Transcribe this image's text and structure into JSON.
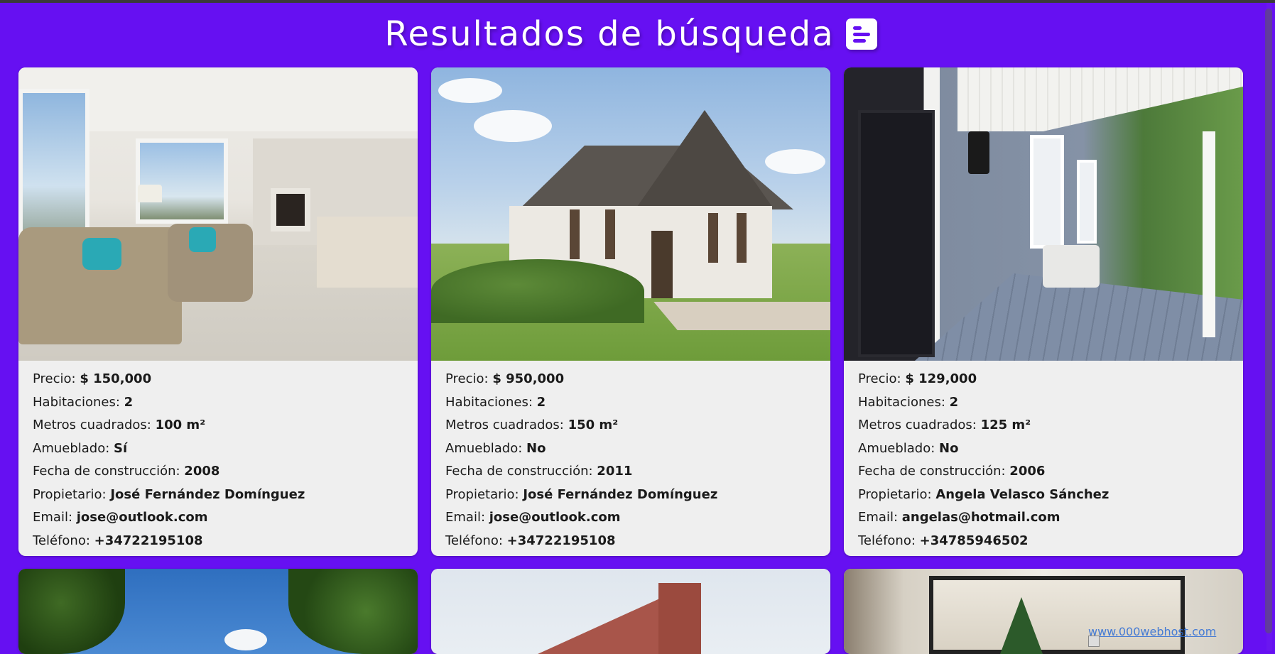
{
  "page": {
    "title": "Resultados de búsqueda",
    "title_icon": "list-icon"
  },
  "labels": {
    "price": "Precio:",
    "rooms": "Habitaciones:",
    "area": "Metros cuadrados:",
    "furnished": "Amueblado:",
    "built": "Fecha de construcción:",
    "owner": "Propietario:",
    "email": "Email:",
    "phone": "Teléfono:"
  },
  "listings": [
    {
      "price": "$ 150,000",
      "rooms": "2",
      "area": "100 m²",
      "furnished": "Sí",
      "built": "2008",
      "owner": "José Fernández Domínguez",
      "email": "jose@outlook.com",
      "phone": "+34722195108"
    },
    {
      "price": "$ 950,000",
      "rooms": "2",
      "area": "150 m²",
      "furnished": "No",
      "built": "2011",
      "owner": "José Fernández Domínguez",
      "email": "jose@outlook.com",
      "phone": "+34722195108"
    },
    {
      "price": "$ 129,000",
      "rooms": "2",
      "area": "125 m²",
      "furnished": "No",
      "built": "2006",
      "owner": "Angela Velasco Sánchez",
      "email": "angelas@hotmail.com",
      "phone": "+34785946502"
    }
  ],
  "watermark": {
    "text": "www.000webhost.com"
  },
  "colors": {
    "background": "#6610f2",
    "card": "#efefef",
    "text": "#1a1a1a"
  }
}
